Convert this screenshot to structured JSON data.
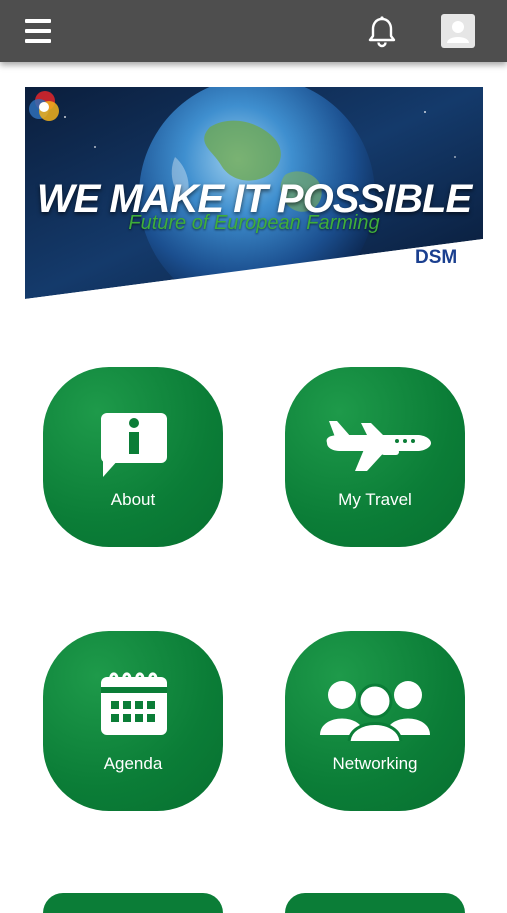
{
  "header": {
    "menu_icon": "hamburger-menu-icon",
    "notification_icon": "bell-icon",
    "profile_icon": "user-avatar-icon",
    "background_color": "#4e4e4e"
  },
  "banner": {
    "headline": "WE MAKE IT POSSIBLE",
    "subline": "Future of European Farming",
    "logo_text": "DSM"
  },
  "tiles": [
    {
      "label": "About",
      "icon": "info-speech-bubble-icon"
    },
    {
      "label": "My Travel",
      "icon": "airplane-icon"
    },
    {
      "label": "Agenda",
      "icon": "calendar-icon"
    },
    {
      "label": "Networking",
      "icon": "people-group-icon"
    }
  ],
  "colors": {
    "tile_green": "#0b7d37",
    "accent_green": "#3fae3a",
    "brand_blue": "#1a3f8f"
  }
}
